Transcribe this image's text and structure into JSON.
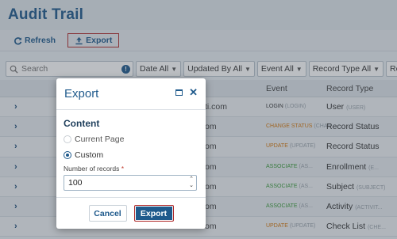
{
  "page": {
    "title": "Audit Trail"
  },
  "toolbar": {
    "refresh_label": "Refresh",
    "export_label": "Export"
  },
  "filters": {
    "search_placeholder": "Search",
    "info_glyph": "!",
    "items": [
      "Date All",
      "Updated By All",
      "Event All",
      "Record Type All",
      "Reli"
    ]
  },
  "grid": {
    "columns": {
      "event": "Event",
      "record_type": "Record Type"
    },
    "rows": [
      {
        "email": "ti.com",
        "event": "LOGIN",
        "event_sub": "(LOGIN)",
        "event_color": "#333333",
        "record_type": "User",
        "record_type_sub": "(USER)"
      },
      {
        "email": "om",
        "event": "CHANGE STATUS",
        "event_sub": "(CHAN...",
        "event_color": "#d4760a",
        "record_type": "Record Status",
        "record_type_sub": ""
      },
      {
        "email": "om",
        "event": "UPDATE",
        "event_sub": "(UPDATE)",
        "event_color": "#d4760a",
        "record_type": "Record Status",
        "record_type_sub": ""
      },
      {
        "email": "om",
        "event": "ASSOCIATE",
        "event_sub": "(AS...",
        "event_color": "#3a9a3a",
        "record_type": "Enrollment",
        "record_type_sub": "(E..."
      },
      {
        "email": "om",
        "event": "ASSOCIATE",
        "event_sub": "(AS...",
        "event_color": "#3a9a3a",
        "record_type": "Subject",
        "record_type_sub": "(SUBJECT)"
      },
      {
        "email": "om",
        "event": "ASSOCIATE",
        "event_sub": "(AS...",
        "event_color": "#3a9a3a",
        "record_type": "Activity",
        "record_type_sub": "(ACTIVIT..."
      },
      {
        "email": "om",
        "event": "UPDATE",
        "event_sub": "(UPDATE)",
        "event_color": "#d4760a",
        "record_type": "Check List",
        "record_type_sub": "(CHE..."
      }
    ]
  },
  "modal": {
    "title": "Export",
    "section_title": "Content",
    "options": [
      {
        "label": "Current Page",
        "checked": false
      },
      {
        "label": "Custom",
        "checked": true
      }
    ],
    "number_label": "Number of records",
    "required_mark": "*",
    "number_value": "100",
    "cancel_label": "Cancel",
    "export_label": "Export"
  },
  "colors": {
    "accent": "#1f5a8c",
    "highlight_border": "#b02a2a"
  }
}
